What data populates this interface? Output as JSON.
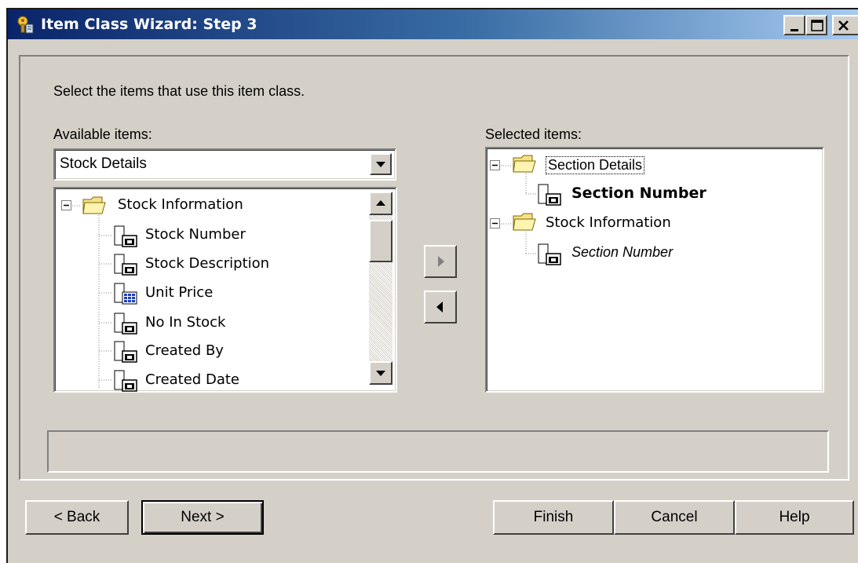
{
  "window": {
    "title": "Item Class Wizard: Step 3"
  },
  "instruction": "Select the items that use this item class.",
  "available": {
    "label": "Available items:",
    "combo_value": "Stock Details",
    "tree": [
      {
        "label": "Stock Information",
        "type": "folder"
      },
      {
        "label": "Stock Number",
        "type": "item"
      },
      {
        "label": "Stock Description",
        "type": "item"
      },
      {
        "label": "Unit Price",
        "type": "calc-item"
      },
      {
        "label": "No In Stock",
        "type": "item"
      },
      {
        "label": "Created By",
        "type": "item"
      },
      {
        "label": "Created Date",
        "type": "item"
      }
    ]
  },
  "selected": {
    "label": "Selected items:",
    "tree": [
      {
        "label": "Section Details",
        "type": "folder",
        "focused": true
      },
      {
        "label": "Section Number",
        "type": "item",
        "style": "bold"
      },
      {
        "label": "Stock Information",
        "type": "folder"
      },
      {
        "label": "Section Number",
        "type": "item",
        "style": "italic"
      }
    ]
  },
  "buttons": {
    "back": "< Back",
    "next": "Next >",
    "finish": "Finish",
    "cancel": "Cancel",
    "help": "Help"
  },
  "icons": {
    "title": "wizard-key-icon",
    "folder": "folder-icon",
    "item": "item-icon",
    "calc_item": "calculated-item-icon"
  }
}
